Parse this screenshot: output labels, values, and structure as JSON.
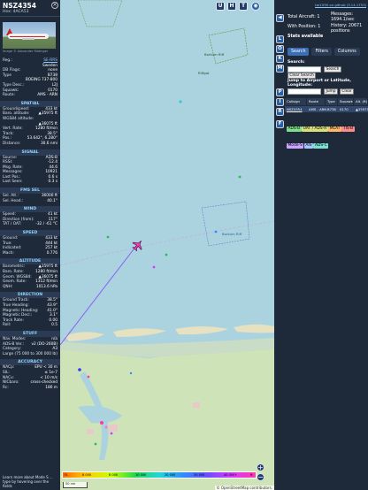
{
  "info": {
    "callsign": "NSZ4354",
    "hex": "Hex: 4ACA53",
    "photo_credit": "Image © Alexander Rüdinger",
    "reg_label": "Reg.:",
    "reg": "SE-RRS",
    "country": "Sweden",
    "db_flags_label": "DB Flags:",
    "db_flags": "none",
    "type_label": "Type",
    "type": "B738",
    "model": "BOEING 737-800",
    "type_desc_label": "Type Desc.:",
    "type_desc": "L2J",
    "squawk_label": "Squawk:",
    "squawk": "0170",
    "route_label": "Route:",
    "route": "AMS - ARN",
    "spatial": {
      "title": "SPATIAL",
      "rows": [
        [
          "Groundspeed:",
          "433 kt"
        ],
        [
          "Baro. altitude:",
          "▲35975 ft"
        ],
        [
          "WGS84 altitude:",
          ""
        ],
        [
          "",
          "▲36075 ft"
        ],
        [
          "Vert. Rate:",
          "1280 ft/min"
        ],
        [
          "Track:",
          "38.5°"
        ],
        [
          "Pos.:",
          "53.642°, 6.280°"
        ],
        [
          "Distance:",
          "30.6 nmi"
        ]
      ]
    },
    "signal": {
      "title": "SIGNAL",
      "rows": [
        [
          "Source:",
          "ADS-B"
        ],
        [
          "RSSI:",
          "-12.4"
        ],
        [
          "Msg. Rate:",
          "44.6"
        ],
        [
          "Messages:",
          "10921"
        ],
        [
          "Last Pos.:",
          "0.6 s"
        ],
        [
          "Last Seen:",
          "0.3 s"
        ]
      ]
    },
    "fms": {
      "title": "FMS SEL",
      "rows": [
        [
          "Sel. Alt.:",
          "36000 ft"
        ],
        [
          "Sel. Head.:",
          "40.1°"
        ]
      ]
    },
    "wind": {
      "title": "WIND",
      "rows": [
        [
          "Speed:",
          "41 kt"
        ],
        [
          "Direction (from):",
          "117°"
        ],
        [
          "TAT / OAT:",
          "-32 / -61 °C"
        ]
      ]
    },
    "speed": {
      "title": "SPEED",
      "rows": [
        [
          "Ground:",
          "433 kt"
        ],
        [
          "True:",
          "444 kt"
        ],
        [
          "Indicated:",
          "257 kt"
        ],
        [
          "Mach:",
          "0.776"
        ]
      ]
    },
    "altitude": {
      "title": "ALTITUDE",
      "rows": [
        [
          "Barometric:",
          "▲35975 ft"
        ],
        [
          "Baro. Rate:",
          "1280 ft/min"
        ],
        [
          "Geom. WGS84:",
          "▲36075 ft"
        ],
        [
          "Geom. Rate:",
          "1312 ft/min"
        ],
        [
          "QNH:",
          "1013.6 hPa"
        ]
      ]
    },
    "direction": {
      "title": "DIRECTION",
      "rows": [
        [
          "Ground Track:",
          "38.5°"
        ],
        [
          "True Heading:",
          "43.9°"
        ],
        [
          "Magnetic Heading:",
          "41.0°"
        ],
        [
          "Magnetic Decl.:",
          "3.1°"
        ],
        [
          "Track Rate:",
          "0.00"
        ],
        [
          "Roll:",
          "0.5"
        ]
      ]
    },
    "stuff": {
      "title": "STUFF",
      "rows": [
        [
          "Nav. Modes:",
          "n/a"
        ],
        [
          "ADS-B Ver.:",
          "v2 (DO-260B)"
        ],
        [
          "Category:",
          "A3"
        ],
        [
          "Large (75 000 to 300 000 lb)",
          ""
        ]
      ]
    },
    "accuracy": {
      "title": "ACCURACY",
      "rows": [
        [
          "NACp:",
          "EPU < 30 m"
        ],
        [
          "SIL:",
          "≤ 1e-7"
        ],
        [
          "NACv:",
          "< 10 m/s"
        ],
        [
          "NICbaro:",
          "cross-checked"
        ],
        [
          "Rc:",
          "186 m"
        ]
      ]
    },
    "footer": "Learn more about Mode S ... type by hovering over the fields"
  },
  "map": {
    "top_buttons": [
      "U",
      "H",
      "T"
    ],
    "labels": {
      "borkum_riff": "Borkum Riff",
      "borkum": "Borkum Riff",
      "riffgat": "Riffgat"
    },
    "legend": {
      "ticks": [
        "6 000",
        "8 000",
        "10 000",
        "20 000",
        "30 000",
        "40 000+"
      ],
      "unit_left": "FL",
      "unit_right": "ft"
    },
    "scale": "50 nm",
    "attribution": "© OpenStreetMap contributors.",
    "zoom_in": "+",
    "zoom_out": "−",
    "aircraft_color": "#ff3aa8",
    "track_color": "#8b5cf6",
    "water_color": "#aad3df",
    "land_color": "#cfe3b8"
  },
  "panel": {
    "side_buttons": [
      "◀",
      "L",
      "O",
      "K",
      "M",
      "P",
      "I",
      "R",
      "F"
    ],
    "top_link": "tar1090 on github (3.14.1753)",
    "total_aircraft": "Total Aircraft: 1",
    "with_position": "With Position: 1",
    "messages": "Messages: 1694.1/sec",
    "history": "History: 20671 positions",
    "stats_available": "Stats available",
    "tabs": [
      "Search",
      "Filters",
      "Columns"
    ],
    "search_label": "Search:",
    "search_button": "Search",
    "clear_search": "Clear Search",
    "jump_label": "Jump to Airport or Latitude, Longitude:",
    "jump_button": "Jump",
    "clear_button": "Clear",
    "table_headers": [
      "Callsign",
      "Route",
      "Type",
      "Squawk",
      "Alt. (ft)"
    ],
    "table_row": [
      "NSZ4354",
      "AMS - ARN",
      "B738",
      "0170",
      "▲35975"
    ],
    "filters": [
      {
        "label": "ADS-B",
        "color": "#7ee08b"
      },
      {
        "label": "UAT / ADS-R",
        "color": "#d9e07a"
      },
      {
        "label": "MLAT",
        "color": "#ffb86b"
      },
      {
        "label": "TIS-B",
        "color": "#ff8b8b"
      },
      {
        "label": "Mode-S",
        "color": "#c9a6ff"
      },
      {
        "label": "AIS",
        "color": "#a6c6ff"
      },
      {
        "label": "ADS-C",
        "color": "#7ee0d0"
      }
    ]
  }
}
